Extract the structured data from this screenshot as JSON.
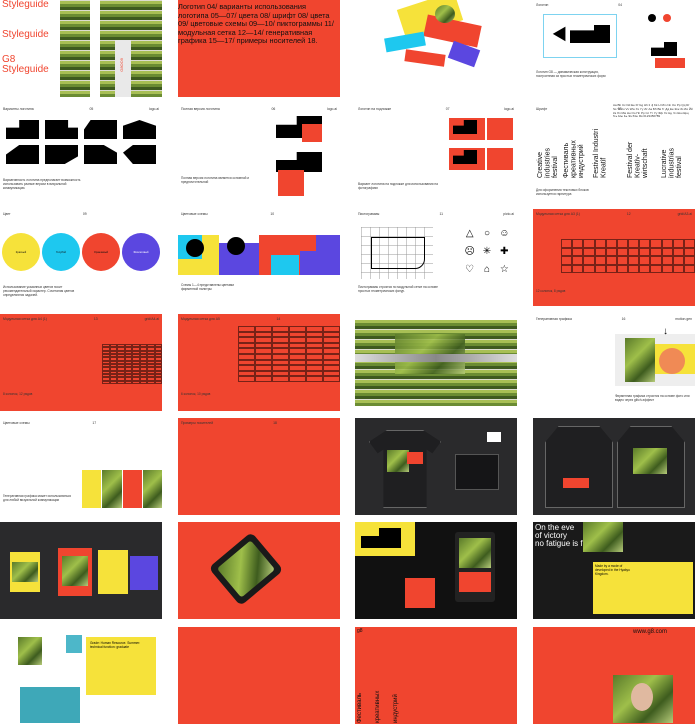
{
  "pages": {
    "p1": {
      "cover_lines": [
        "Styleguide",
        "Styleguide",
        "G8",
        "Styleguide"
      ],
      "vertical_tag": "G8OO9"
    },
    "p2": {
      "text": "Логотип 04/ варианты использования логотипа 05—07/ цвета 08/ шрифт 08/ цвета 09/ цветовые схемы 09—10/ пиктограммы 11/ модульная сетка 12—14/ генеративная графика 15—17/ примеры носителей 18."
    },
    "p4": {
      "label": "Логотип",
      "num": "04",
      "caption": "Логотип G8 — динамическая конструкция, построенная из простых геометрических форм"
    },
    "p5": {
      "label": "Варианты логотипа",
      "num": "05",
      "site": "logo.ai",
      "caption": "Вариативность логотипа предполагает возможность использовать разные версии в визуальной коммуникации."
    },
    "p6": {
      "label": "Полная версия логотипа",
      "num": "06",
      "site": "logo.ai",
      "caption": "Полная версия логотипа является основной и предпочтительной"
    },
    "p7": {
      "label": "Логотип на подложке",
      "num": "07",
      "site": "logo.ai",
      "caption": "Вариант логотипа на подложке для использования на фотографиях"
    },
    "p8": {
      "label": "Шрифт",
      "num": "08",
      "alphabet": "Aa Bb Cc Dd Ee Ff Gg Hh Ii Jj Kk Ll Mm Nn Oo Pp Qq Rr Ss Tt Uu Vv Ww Xx Yy Zz Аа Бб Вв Гг Дд Ее Жж Зз Ии Йй Кк Лл Мм Нн Оо Пп Рр Сс Тт Уу Фф Хх Цц Чч Шш Щщ Ъъ Ыы Ьь Ээ Юю Яя 0123456789",
      "vertical": [
        "Creative industries festival",
        "Фестиваль креативных индустрий",
        "Festival Industri Kreatif",
        "Festival der Kreativ-wirtschaft",
        "Lucrative industrias festival"
      ],
      "caption": "Для оформления текстовых блоков используется гарнитура"
    },
    "p9": {
      "label": "Цвет",
      "num": "09",
      "circles": [
        "Красный",
        "Голубой",
        "Оранжевый",
        "Фиолетовый"
      ],
      "caption": "Использование указанных цветов носит рекомендательный характер. Сочетания цветов определяются задачей."
    },
    "p10": {
      "label": "Цветовые схемы",
      "num": "10",
      "caption": "Схемы 1—4 представлены цветами фирменной палитры"
    },
    "p11": {
      "label": "Пиктограммы",
      "num": "11",
      "site": "picto.ai",
      "caption": "Пиктограммы строятся по модульной сетке на основе простых геометрических фигур."
    },
    "p12": {
      "label": "Модульная сетка для A3 (1)",
      "num": "12",
      "site": "grid/A3.ai",
      "caption": "12 колонок, 8 рядов"
    },
    "p13": {
      "label": "Модульная сетка для A4 (1)",
      "num": "13",
      "site": "grid/A4.ai",
      "caption": "8 колонок, 12 рядов"
    },
    "p14": {
      "label": "Модульная сетка для A5",
      "num": "14",
      "caption": "6 колонок, 10 рядов"
    },
    "p16": {
      "label": "Генеративная графика",
      "num": "16",
      "site": "motion.gen",
      "caption": "Фирменная графика строится на основе фото или видео через glitch-эффект"
    },
    "p17": {
      "label": "Цветовые схемы",
      "num": "17",
      "caption": "Генеративная графика может использоваться для любой визуальной коммуникации"
    },
    "p18": {
      "label": "Примеры носителей",
      "num": "18"
    },
    "p20": {
      "num": "20"
    },
    "p24": {
      "lines": [
        "On the eve",
        "of victory",
        "no fatigue is felt."
      ],
      "sub": "Made by a mode of developed in the Hyakyu Kingdom."
    },
    "p25": {
      "note": "Grade: Human Resource. Summer: technical function: graduate"
    },
    "p28": {
      "logo_text": "g8",
      "vertical_text": [
        "Фестиваль",
        "креативных",
        "индустрий"
      ]
    },
    "p27": {
      "site": "www.g8.com"
    }
  }
}
